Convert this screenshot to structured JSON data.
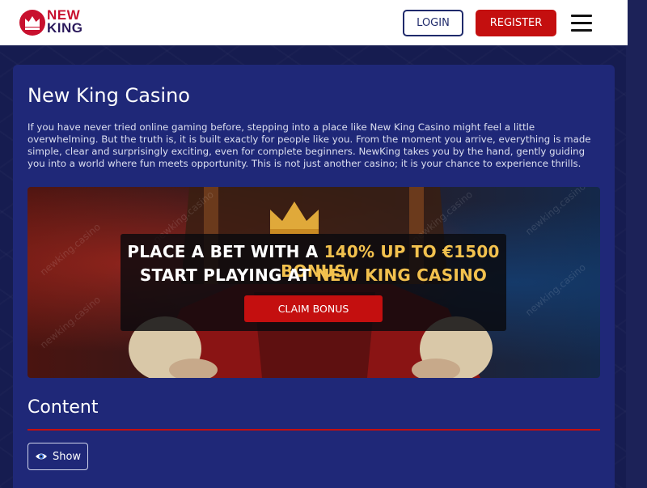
{
  "brand": {
    "logo_line1": "NEW",
    "logo_line2": "KING",
    "accent": "#c40f0f",
    "navy": "#1f2878"
  },
  "header": {
    "login_label": "LOGIN",
    "register_label": "REGISTER",
    "menu_icon": "hamburger-menu-icon"
  },
  "main": {
    "title": "New King Casino",
    "intro": "If you have never tried online gaming before, stepping into a place like New King Casino might feel a little overwhelming. But the truth is, it is built exactly for people like you. From the moment you arrive, everything is made simple, clear and surprisingly exciting, even for complete beginners. NewKing takes you by the hand, gently guiding you into a world where fun meets opportunity. This is not just another casino; it is your chance to experience thrills."
  },
  "banner": {
    "line1_prefix": "PLACE A BET WITH A ",
    "line1_highlight": "140% UP TO €1500 BONUS",
    "line2_prefix": "START PLAYING AT ",
    "line2_highlight": "NEW KING CASINO",
    "cta_label": "CLAIM BONUS",
    "watermark": "newking.casino",
    "highlight_color": "#f2c14e"
  },
  "content_section": {
    "title": "Content",
    "show_label": "Show",
    "show_icon": "eye-icon"
  }
}
